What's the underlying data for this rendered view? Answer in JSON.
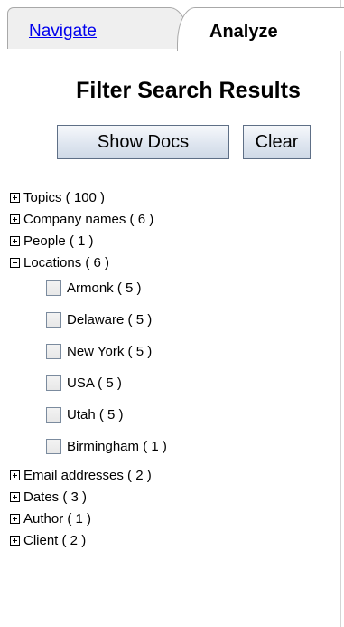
{
  "tabs": [
    {
      "label": "Navigate",
      "active": false
    },
    {
      "label": "Analyze",
      "active": true
    }
  ],
  "title": "Filter Search Results",
  "buttons": {
    "show_docs": "Show Docs",
    "clear": "Clear"
  },
  "tree": [
    {
      "label": "Topics ( 100 )",
      "expanded": false
    },
    {
      "label": "Company names ( 6 )",
      "expanded": false
    },
    {
      "label": "People ( 1 )",
      "expanded": false
    },
    {
      "label": "Locations ( 6 )",
      "expanded": true,
      "children": [
        {
          "label": "Armonk ( 5 )",
          "checked": false
        },
        {
          "label": "Delaware ( 5 )",
          "checked": false
        },
        {
          "label": "New York ( 5 )",
          "checked": false
        },
        {
          "label": "USA ( 5 )",
          "checked": false
        },
        {
          "label": "Utah ( 5 )",
          "checked": false
        },
        {
          "label": "Birmingham ( 1 )",
          "checked": false
        }
      ]
    },
    {
      "label": "Email addresses ( 2 )",
      "expanded": false
    },
    {
      "label": "Dates ( 3 )",
      "expanded": false
    },
    {
      "label": "Author ( 1 )",
      "expanded": false
    },
    {
      "label": "Client ( 2 )",
      "expanded": false
    }
  ]
}
